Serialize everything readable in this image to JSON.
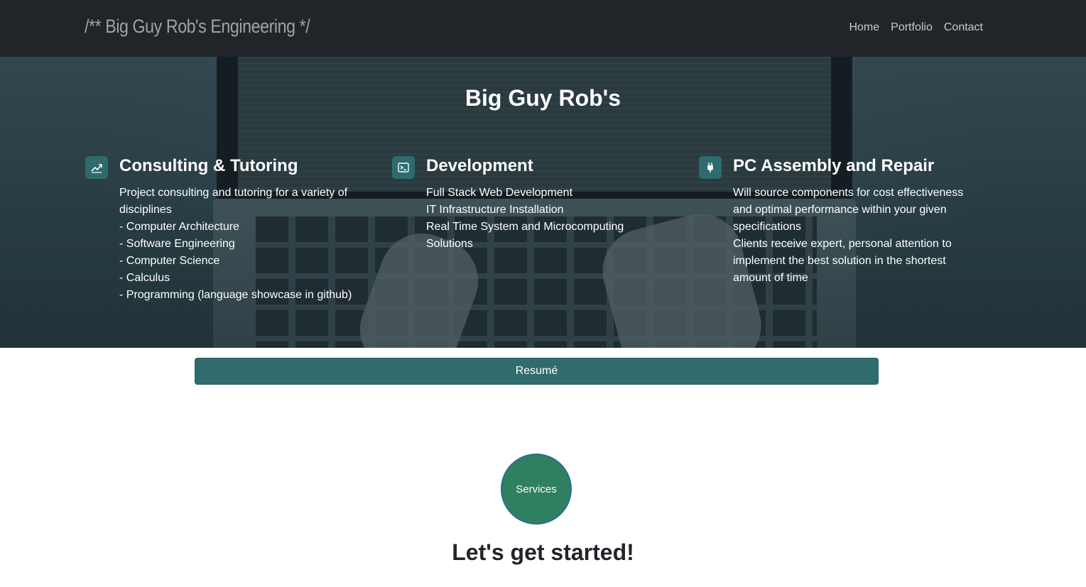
{
  "navbar": {
    "brand": "/** Big Guy Rob's Engineering */",
    "links": [
      "Home",
      "Portfolio",
      "Contact"
    ]
  },
  "hero": {
    "title": "Big Guy Rob's",
    "features": [
      {
        "icon": "chart-line-icon",
        "title": "Consulting & Tutoring",
        "lines": [
          "Project consulting and tutoring for a variety of disciplines",
          "- Computer Architecture",
          "- Software Engineering",
          "- Computer Science",
          "- Calculus",
          "- Programming (language showcase in github)"
        ]
      },
      {
        "icon": "terminal-icon",
        "title": "Development",
        "lines": [
          "Full Stack Web Development",
          "IT Infrastructure Installation",
          "Real Time System and Microcomputing Solutions"
        ]
      },
      {
        "icon": "plug-icon",
        "title": "PC Assembly and Repair",
        "lines": [
          "Will source components for cost effectiveness and optimal performance within your given specifications",
          "Clients receive expert, personal attention to implement the best solution in the shortest amount of time"
        ]
      }
    ]
  },
  "resume_button": "Resumé",
  "services_button": "Services",
  "cta": "Let's get started!",
  "colors": {
    "navbar_bg": "#212529",
    "accent_teal": "#306b6d",
    "services_green": "#2f8060"
  }
}
